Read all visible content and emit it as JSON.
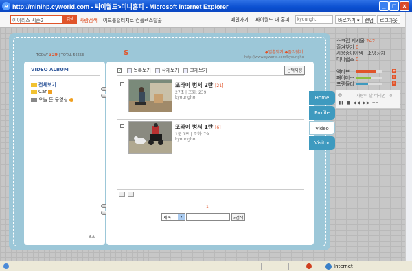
{
  "window": {
    "title": "http://minihp.cyworld.com - 싸이월드>미니홈피 - Microsoft Internet Explorer"
  },
  "topbar": {
    "search_value": "이이리스 시즌2",
    "search_btn": "검색",
    "people_search": "사람검색",
    "promo": "여드름흉터지로 컴플렉스탈출",
    "nav": [
      "메인가기",
      "싸이월드 내 홈피"
    ],
    "user_field": "kyoungh,",
    "goto_btn": "바로가기 ▾",
    "random_btn": "랜덤",
    "logout_btn": "로그아웃"
  },
  "profile": {
    "today_label": "TODAY",
    "today_count": "329",
    "total_label": "TOTAL",
    "total_count": "56653",
    "logo": "S",
    "links": "◆일촌맺기 ◆즐겨찾기",
    "url": "http://www.cyworld.com/kyoungho"
  },
  "album": {
    "title": "VIDEO ALBUM",
    "items": [
      {
        "label": "전체보기"
      },
      {
        "label": "Car"
      },
      {
        "label": "오늘 뜬 동영상"
      }
    ]
  },
  "viewbar": {
    "list_view": "목록보기",
    "small_view": "작게보기",
    "large_view": "크게보기",
    "select_btn": "선택재생"
  },
  "videos": [
    {
      "title": "또라이 벙서 2탄",
      "count": "[21]",
      "meta": "27초 | 조회: 239",
      "author": "kyoungho"
    },
    {
      "title": "또라이 벙서 1탄",
      "count": "[6]",
      "meta": "1분 1초 | 조회: 79",
      "author": "kyoungho"
    }
  ],
  "pager": {
    "current": "1"
  },
  "search": {
    "select_label": "제목",
    "btn": "검색"
  },
  "tabs": [
    "Home",
    "Profile",
    "Video",
    "Visitor"
  ],
  "sidebar": {
    "scrap": "스크랩 게시물",
    "scrap_n": "242",
    "fav": "즐겨찾기",
    "fav_n": "0",
    "items_label": "사용중아이템 · 소망상자",
    "minilabs": "미니랩스",
    "minilabs_n": "0",
    "stats": [
      {
        "label": "액티브",
        "level": 0.75,
        "color": "#e0542a"
      },
      {
        "label": "패이머스",
        "level": 0.55,
        "color": "#8cbf3c"
      },
      {
        "label": "프렌들리",
        "level": 0.45,
        "color": "#3e9abf"
      }
    ]
  },
  "player": {
    "text": "사랑이 날 버리면 - 0"
  },
  "status": {
    "zone": "Internet"
  }
}
